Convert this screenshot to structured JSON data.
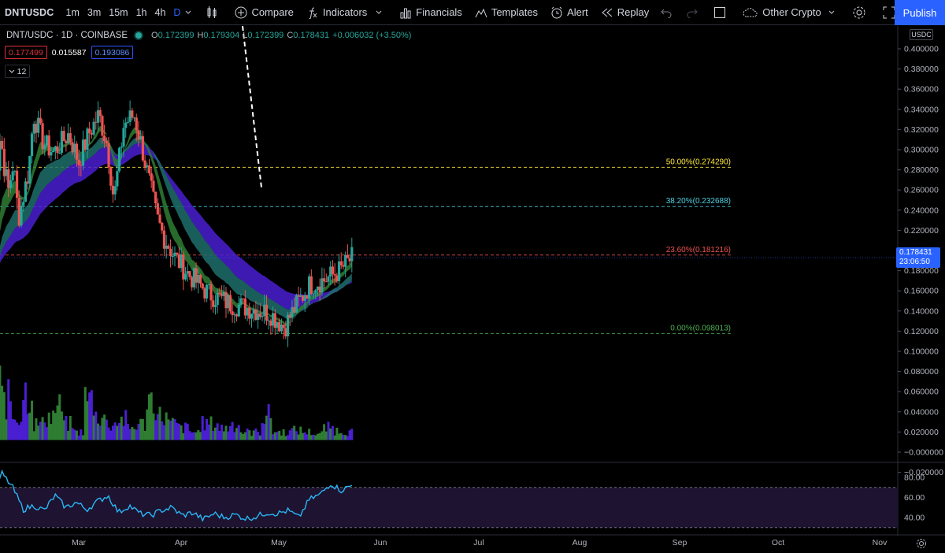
{
  "toolbar": {
    "symbol": "DNTUSDC",
    "intervals": [
      "1m",
      "3m",
      "15m",
      "1h",
      "4h",
      "D"
    ],
    "active_interval": "D",
    "compare": "Compare",
    "indicators": "Indicators",
    "financials": "Financials",
    "templates": "Templates",
    "alert": "Alert",
    "replay": "Replay",
    "watchlist": "Other Crypto",
    "publish": "Publish"
  },
  "legend": {
    "title": "DNT/USDC · 1D · COINBASE",
    "o_label": "O",
    "o": "0.172399",
    "h_label": "H",
    "h": "0.179304",
    "l_label": "L",
    "l": "0.172399",
    "c_label": "C",
    "c": "0.178431",
    "change": "+0.006032 (+3.50%)"
  },
  "indicator_values": {
    "red": "0.177499",
    "white": "0.015587",
    "blue": "0.193086"
  },
  "collapse_count": "12",
  "price_axis": {
    "unit": "USDC",
    "ticks": [
      "0.400000",
      "0.380000",
      "0.360000",
      "0.340000",
      "0.320000",
      "0.300000",
      "0.280000",
      "0.260000",
      "0.240000",
      "0.220000",
      "0.200000",
      "0.180000",
      "0.160000",
      "0.140000",
      "0.120000",
      "0.100000",
      "0.080000",
      "0.060000",
      "0.040000",
      "0.020000",
      "−0.000000",
      "−0.020000"
    ],
    "last_price": "0.178431",
    "countdown": "23:06:50"
  },
  "fib_labels": [
    {
      "text": "50.00%(0.274290)",
      "color": "#ffeb3b",
      "price": 0.27429
    },
    {
      "text": "38.20%(0.232688)",
      "color": "#4dd0e1",
      "price": 0.232688
    },
    {
      "text": "23.60%(0.181216)",
      "color": "#ef5350",
      "price": 0.181216
    },
    {
      "text": "0.00%(0.098013)",
      "color": "#4caf50",
      "price": 0.098013
    }
  ],
  "rsi_axis": {
    "ticks": [
      "80.00",
      "60.00",
      "40.00"
    ]
  },
  "time_axis": {
    "labels": [
      "Mar",
      "Apr",
      "May",
      "Jun",
      "Jul",
      "Aug",
      "Sep",
      "Oct",
      "Nov"
    ]
  },
  "chart_data": {
    "type": "candlestick",
    "symbol": "DNT/USDC",
    "timeframe": "1D",
    "exchange": "COINBASE",
    "ylim": [
      -0.02,
      0.4
    ],
    "price_path": [
      [
        0.13,
        0.16
      ],
      [
        0.18,
        0.26
      ],
      [
        0.22,
        0.31
      ],
      [
        0.25,
        0.28
      ],
      [
        0.3,
        0.25
      ],
      [
        0.35,
        0.28
      ],
      [
        0.4,
        0.22
      ],
      [
        0.5,
        0.27
      ],
      [
        0.55,
        0.33
      ],
      [
        0.65,
        0.3
      ],
      [
        0.75,
        0.29
      ],
      [
        0.9,
        0.31
      ],
      [
        1.0,
        0.28
      ],
      [
        1.1,
        0.31
      ],
      [
        1.2,
        0.33
      ],
      [
        1.28,
        0.3
      ],
      [
        1.35,
        0.24
      ],
      [
        1.45,
        0.32
      ],
      [
        1.55,
        0.33
      ],
      [
        1.62,
        0.3
      ],
      [
        1.7,
        0.26
      ],
      [
        1.78,
        0.22
      ],
      [
        1.85,
        0.2
      ],
      [
        1.95,
        0.18
      ],
      [
        2.1,
        0.16
      ],
      [
        2.3,
        0.14
      ],
      [
        2.5,
        0.13
      ],
      [
        2.7,
        0.125
      ],
      [
        2.9,
        0.12
      ],
      [
        3.05,
        0.105
      ],
      [
        3.15,
        0.125
      ],
      [
        3.3,
        0.15
      ],
      [
        3.45,
        0.155
      ],
      [
        3.6,
        0.165
      ],
      [
        3.72,
        0.178
      ]
    ],
    "volume": [
      0.07,
      0.05,
      0.03,
      0.06,
      0.02,
      0.03,
      0.04,
      0.02,
      0.01,
      0.05,
      0.03,
      0.02,
      0.025,
      0.015,
      0.02,
      0.05,
      0.03,
      0.02,
      0.015,
      0.01,
      0.02,
      0.02,
      0.015,
      0.02,
      0.01,
      0.01,
      0.03,
      0.01,
      0.01,
      0.012,
      0.01,
      0.008,
      0.015,
      0.012,
      0.01
    ],
    "rsi": [
      55,
      84,
      70,
      48,
      52,
      47,
      62,
      50,
      55,
      48,
      56,
      62,
      45,
      52,
      44,
      42,
      47,
      50,
      42,
      45,
      38,
      44,
      40,
      43,
      39,
      41,
      45,
      44,
      47,
      40,
      58,
      63,
      74,
      67,
      72
    ]
  }
}
